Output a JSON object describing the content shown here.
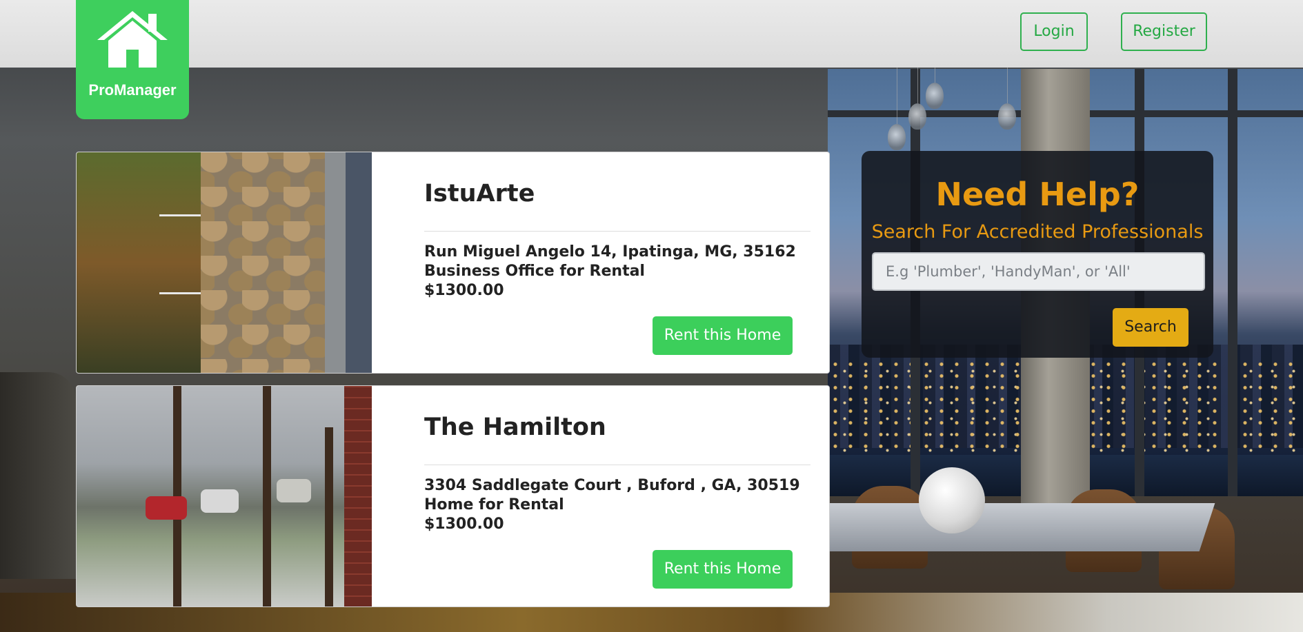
{
  "header": {
    "logo_text": "ProManager",
    "login_label": "Login",
    "register_label": "Register"
  },
  "listings": [
    {
      "title": "IstuArte",
      "address": "Run Miguel Angelo 14, Ipatinga, MG, 35162",
      "type": "Business Office for Rental",
      "price": "$1300.00",
      "button_label": "Rent this Home"
    },
    {
      "title": "The Hamilton",
      "address": "3304 Saddlegate Court , Buford , GA, 30519",
      "type": "Home for Rental",
      "price": "$1300.00",
      "button_label": "Rent this Home"
    }
  ],
  "help": {
    "title": "Need Help?",
    "subtitle": "Search For Accredited Professionals",
    "search_placeholder": "E.g 'Plumber', 'HandyMan', or 'All'",
    "search_value": "",
    "search_button": "Search"
  },
  "colors": {
    "brand_green": "#3ecf5d",
    "accent_orange": "#e89a12",
    "search_button_yellow": "#e4ab14"
  },
  "icons": {
    "logo": "house-icon"
  }
}
